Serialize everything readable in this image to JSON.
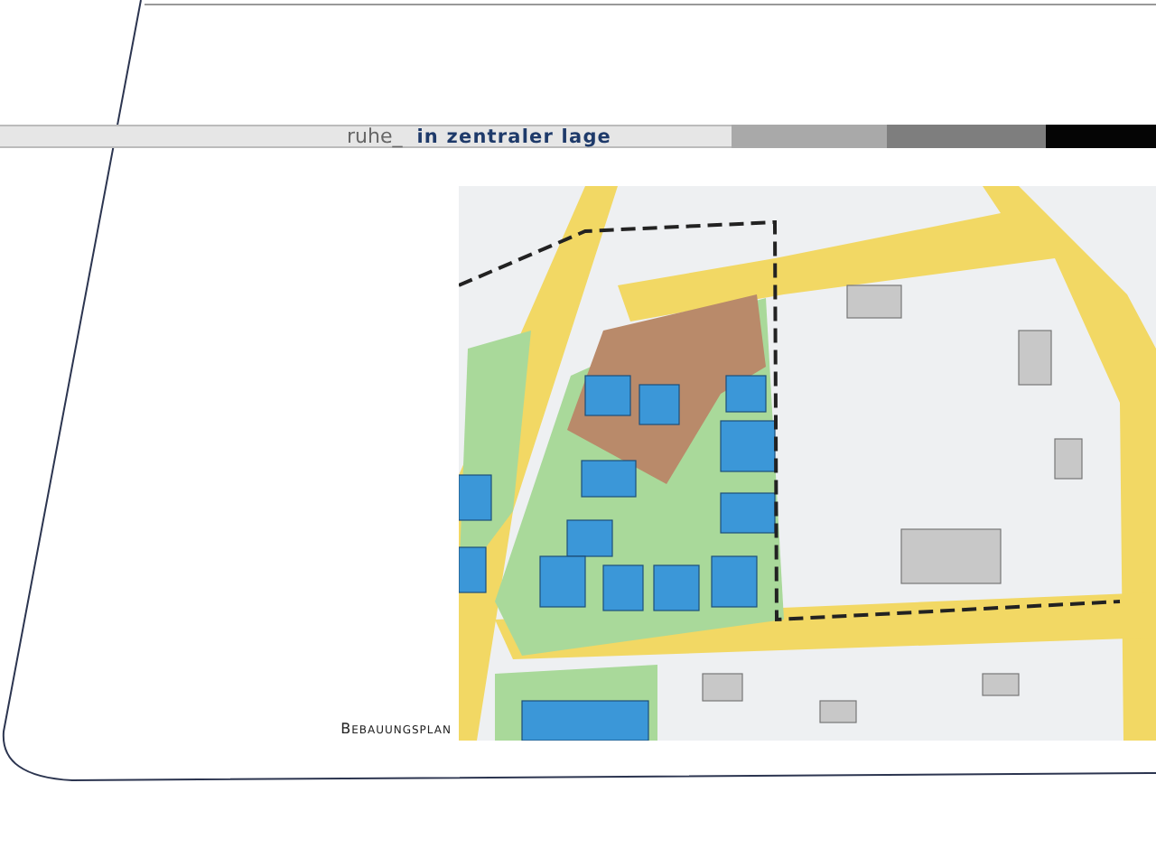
{
  "header": {
    "prefix": "ruhe_",
    "title": "in zentraler lage"
  },
  "plan": {
    "caption": "Bebauungsplan"
  }
}
